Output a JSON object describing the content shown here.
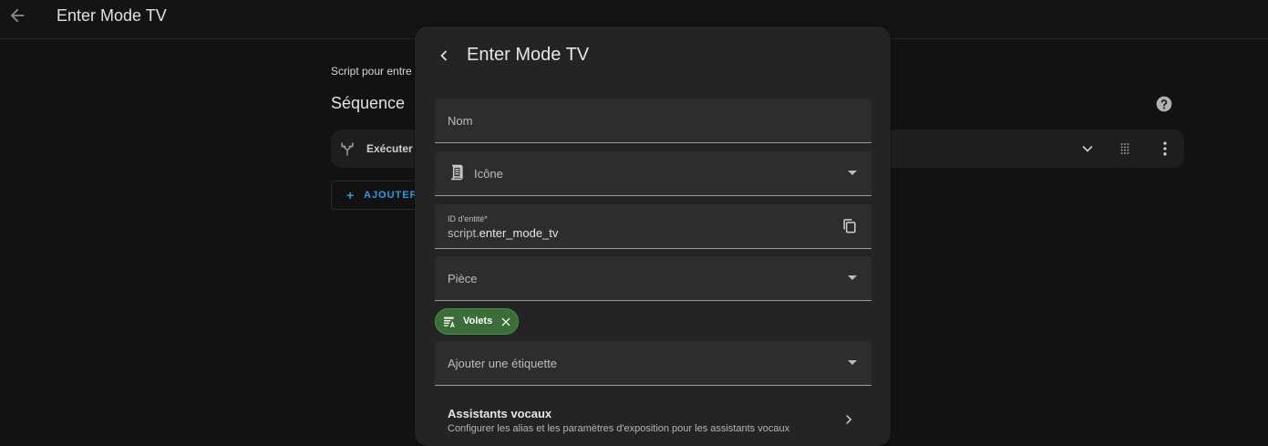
{
  "header": {
    "title": "Enter Mode TV"
  },
  "background": {
    "description": "Script pour entre",
    "section_title": "Séquence",
    "action_label": "Exécuter",
    "add_button": {
      "icon": "+",
      "label": "AJOUTER"
    }
  },
  "dialog": {
    "title": "Enter Mode TV",
    "fields": {
      "name": {
        "label": "Nom"
      },
      "icon": {
        "label": "Icône"
      },
      "entity_id": {
        "label": "ID d'entité*",
        "prefix": "script.",
        "value": "enter_mode_tv"
      },
      "area": {
        "label": "Pièce"
      },
      "label_picker": {
        "label": "Ajouter une étiquette"
      }
    },
    "chips": [
      {
        "label": "Volets",
        "color": "#3a6d37"
      }
    ],
    "voice_assistants": {
      "title": "Assistants vocaux",
      "description": "Configurer les alias et les paramètres d'exposition pour les assistants vocaux"
    }
  },
  "colors": {
    "accent": "#2d9be0",
    "chip": "#3a6d37",
    "background": "#121212",
    "dialog": "#242424"
  },
  "icons": [
    "arrow-left-icon",
    "help-icon",
    "branch-icon",
    "chevron-down-icon",
    "drag-handle-icon",
    "more-vertical-icon",
    "chevron-left-icon",
    "script-icon",
    "copy-icon",
    "label-icon",
    "close-icon",
    "chevron-right-icon"
  ]
}
